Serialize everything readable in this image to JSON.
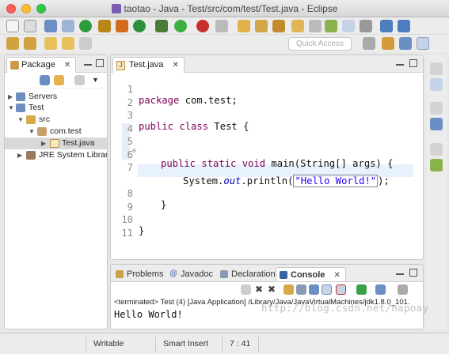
{
  "window": {
    "title": "taotao - Java - Test/src/com/test/Test.java - Eclipse"
  },
  "toolbar": {
    "quick_access_placeholder": "Quick Access"
  },
  "package_explorer": {
    "tab_label": "Package",
    "close_glyph": "✕",
    "tree": [
      {
        "label": "Servers",
        "level": 0,
        "expanded": false,
        "icon": "folder-icon"
      },
      {
        "label": "Test",
        "level": 0,
        "expanded": true,
        "icon": "project-icon"
      },
      {
        "label": "src",
        "level": 1,
        "expanded": true,
        "icon": "source-folder-icon"
      },
      {
        "label": "com.test",
        "level": 2,
        "expanded": true,
        "icon": "package-icon"
      },
      {
        "label": "Test.java",
        "level": 3,
        "expanded": false,
        "icon": "java-file-icon",
        "selected": true
      },
      {
        "label": "JRE System Librar",
        "level": 1,
        "expanded": false,
        "icon": "library-icon"
      }
    ]
  },
  "editor": {
    "tab_label": "Test.java",
    "close_glyph": "✕",
    "lines": [
      {
        "num": "1"
      },
      {
        "num": "2"
      },
      {
        "num": "3"
      },
      {
        "num": "4"
      },
      {
        "num": "5"
      },
      {
        "num": "6"
      },
      {
        "num": "7"
      },
      {
        "num": "8"
      },
      {
        "num": "9"
      },
      {
        "num": "10"
      },
      {
        "num": "11"
      }
    ],
    "code": {
      "l1_kw": "package",
      "l1_rest": " com.test;",
      "l3_kw": "public class",
      "l3_rest": " Test {",
      "l5_kw": "public static void",
      "l5_rest": " main(String[] args) {",
      "l7_a": "System.",
      "l7_out": "out",
      "l7_b": ".println(",
      "l7_str": "\"Hello World!\"",
      "l7_c": ");",
      "l8": "}",
      "l10": "}"
    }
  },
  "bottom_panel": {
    "tabs": [
      {
        "label": "Problems",
        "active": false
      },
      {
        "label": "Javadoc",
        "active": false
      },
      {
        "label": "Declaration",
        "active": false
      },
      {
        "label": "Console",
        "active": true
      }
    ],
    "console_close_glyph": "✕",
    "terminated_line": "<terminated> Test (4) [Java Application] /Library/Java/JavaVirtualMachines/jdk1.8.0_101.",
    "output": "Hello World!"
  },
  "status_bar": {
    "writable": "Writable",
    "insert_mode": "Smart Insert",
    "position": "7 : 41"
  },
  "watermark": "http://blog.csdn.net/napoay",
  "colors": {
    "keyword": "#7f0055",
    "string": "#2a00ff",
    "field": "#0000c0",
    "current_line": "#e8f2fe"
  }
}
